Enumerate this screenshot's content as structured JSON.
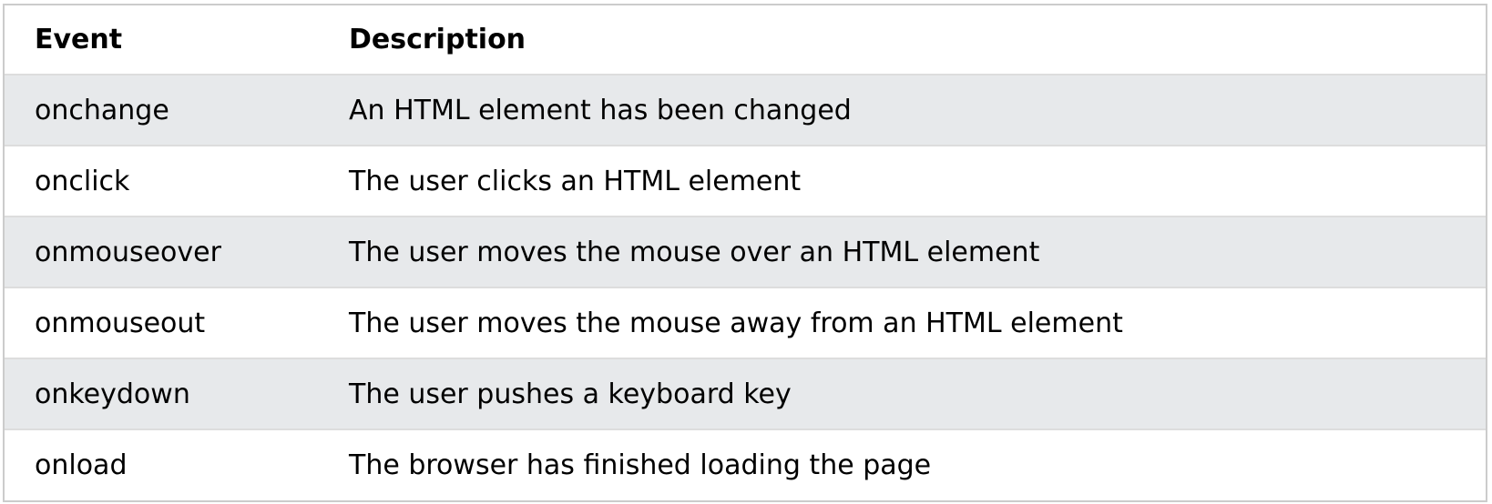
{
  "table": {
    "headers": {
      "event": "Event",
      "description": "Description"
    },
    "rows": [
      {
        "event": "onchange",
        "description": "An HTML element has been changed"
      },
      {
        "event": "onclick",
        "description": "The user clicks an HTML element"
      },
      {
        "event": "onmouseover",
        "description": "The user moves the mouse over an HTML element"
      },
      {
        "event": "onmouseout",
        "description": "The user moves the mouse away from an HTML element"
      },
      {
        "event": "onkeydown",
        "description": "The user pushes a keyboard key"
      },
      {
        "event": "onload",
        "description": "The browser has finished loading the page"
      }
    ]
  },
  "colors": {
    "stripe": "#e7e9eb",
    "border": "#dddddd"
  }
}
